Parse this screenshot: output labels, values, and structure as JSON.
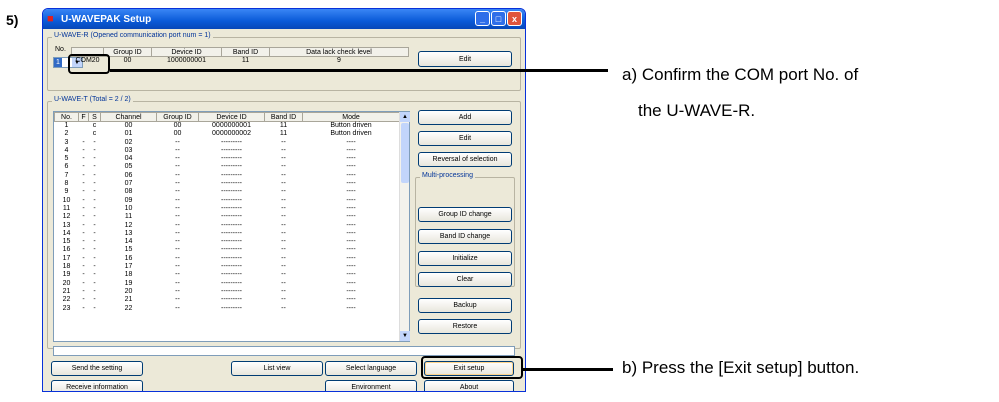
{
  "step_number": "5)",
  "window": {
    "title": "U-WAVEPAK Setup",
    "minimize": "_",
    "maximize": "□",
    "close": "x"
  },
  "receiver": {
    "group_title": "U-WAVE-R (Opened communication port num = 1)",
    "no_label": "No.",
    "no_value": "1",
    "headers": [
      "",
      "Group ID",
      "Device ID",
      "Band ID",
      "Data lack check level"
    ],
    "row": [
      "COM20",
      "00",
      "1000000001",
      "11",
      "9"
    ],
    "edit_label": "Edit"
  },
  "transmitter": {
    "group_title": "U-WAVE-T (Total = 2 / 2)",
    "headers": [
      "No.",
      "F",
      "S",
      "Channel",
      "Group ID",
      "Device ID",
      "Band ID",
      "Mode"
    ],
    "rows": [
      [
        "1",
        "",
        "c",
        "00",
        "00",
        "0000000001",
        "11",
        "Button driven"
      ],
      [
        "2",
        "",
        "c",
        "01",
        "00",
        "0000000002",
        "11",
        "Button driven"
      ],
      [
        "3",
        "-",
        "-",
        "02",
        "--",
        "---------",
        "--",
        "----"
      ],
      [
        "4",
        "-",
        "-",
        "03",
        "--",
        "---------",
        "--",
        "----"
      ],
      [
        "5",
        "-",
        "-",
        "04",
        "--",
        "---------",
        "--",
        "----"
      ],
      [
        "6",
        "-",
        "-",
        "05",
        "--",
        "---------",
        "--",
        "----"
      ],
      [
        "7",
        "-",
        "-",
        "06",
        "--",
        "---------",
        "--",
        "----"
      ],
      [
        "8",
        "-",
        "-",
        "07",
        "--",
        "---------",
        "--",
        "----"
      ],
      [
        "9",
        "-",
        "-",
        "08",
        "--",
        "---------",
        "--",
        "----"
      ],
      [
        "10",
        "-",
        "-",
        "09",
        "--",
        "---------",
        "--",
        "----"
      ],
      [
        "11",
        "-",
        "-",
        "10",
        "--",
        "---------",
        "--",
        "----"
      ],
      [
        "12",
        "-",
        "-",
        "11",
        "--",
        "---------",
        "--",
        "----"
      ],
      [
        "13",
        "-",
        "-",
        "12",
        "--",
        "---------",
        "--",
        "----"
      ],
      [
        "14",
        "-",
        "-",
        "13",
        "--",
        "---------",
        "--",
        "----"
      ],
      [
        "15",
        "-",
        "-",
        "14",
        "--",
        "---------",
        "--",
        "----"
      ],
      [
        "16",
        "-",
        "-",
        "15",
        "--",
        "---------",
        "--",
        "----"
      ],
      [
        "17",
        "-",
        "-",
        "16",
        "--",
        "---------",
        "--",
        "----"
      ],
      [
        "18",
        "-",
        "-",
        "17",
        "--",
        "---------",
        "--",
        "----"
      ],
      [
        "19",
        "-",
        "-",
        "18",
        "--",
        "---------",
        "--",
        "----"
      ],
      [
        "20",
        "-",
        "-",
        "19",
        "--",
        "---------",
        "--",
        "----"
      ],
      [
        "21",
        "-",
        "-",
        "20",
        "--",
        "---------",
        "--",
        "----"
      ],
      [
        "22",
        "-",
        "-",
        "21",
        "--",
        "---------",
        "--",
        "----"
      ],
      [
        "23",
        "-",
        "-",
        "22",
        "--",
        "---------",
        "--",
        "----"
      ]
    ],
    "add_label": "Add",
    "edit_label": "Edit",
    "reversal_label": "Reversal of selection",
    "multi_title": "Multi-processing",
    "group_id_change": "Group ID change",
    "band_id_change": "Band ID change",
    "initialize": "Initialize",
    "clear": "Clear",
    "backup": "Backup",
    "restore": "Restore"
  },
  "bottom": {
    "send_setting": "Send the setting",
    "receive_info": "Receive information",
    "list_view": "List view",
    "select_language": "Select language",
    "environment": "Environment",
    "exit_setup": "Exit setup",
    "about": "About"
  },
  "annotations": {
    "a_line1": "a) Confirm the COM port No. of",
    "a_line2": "the U-WAVE-R.",
    "b": "b) Press the [Exit setup] button."
  }
}
